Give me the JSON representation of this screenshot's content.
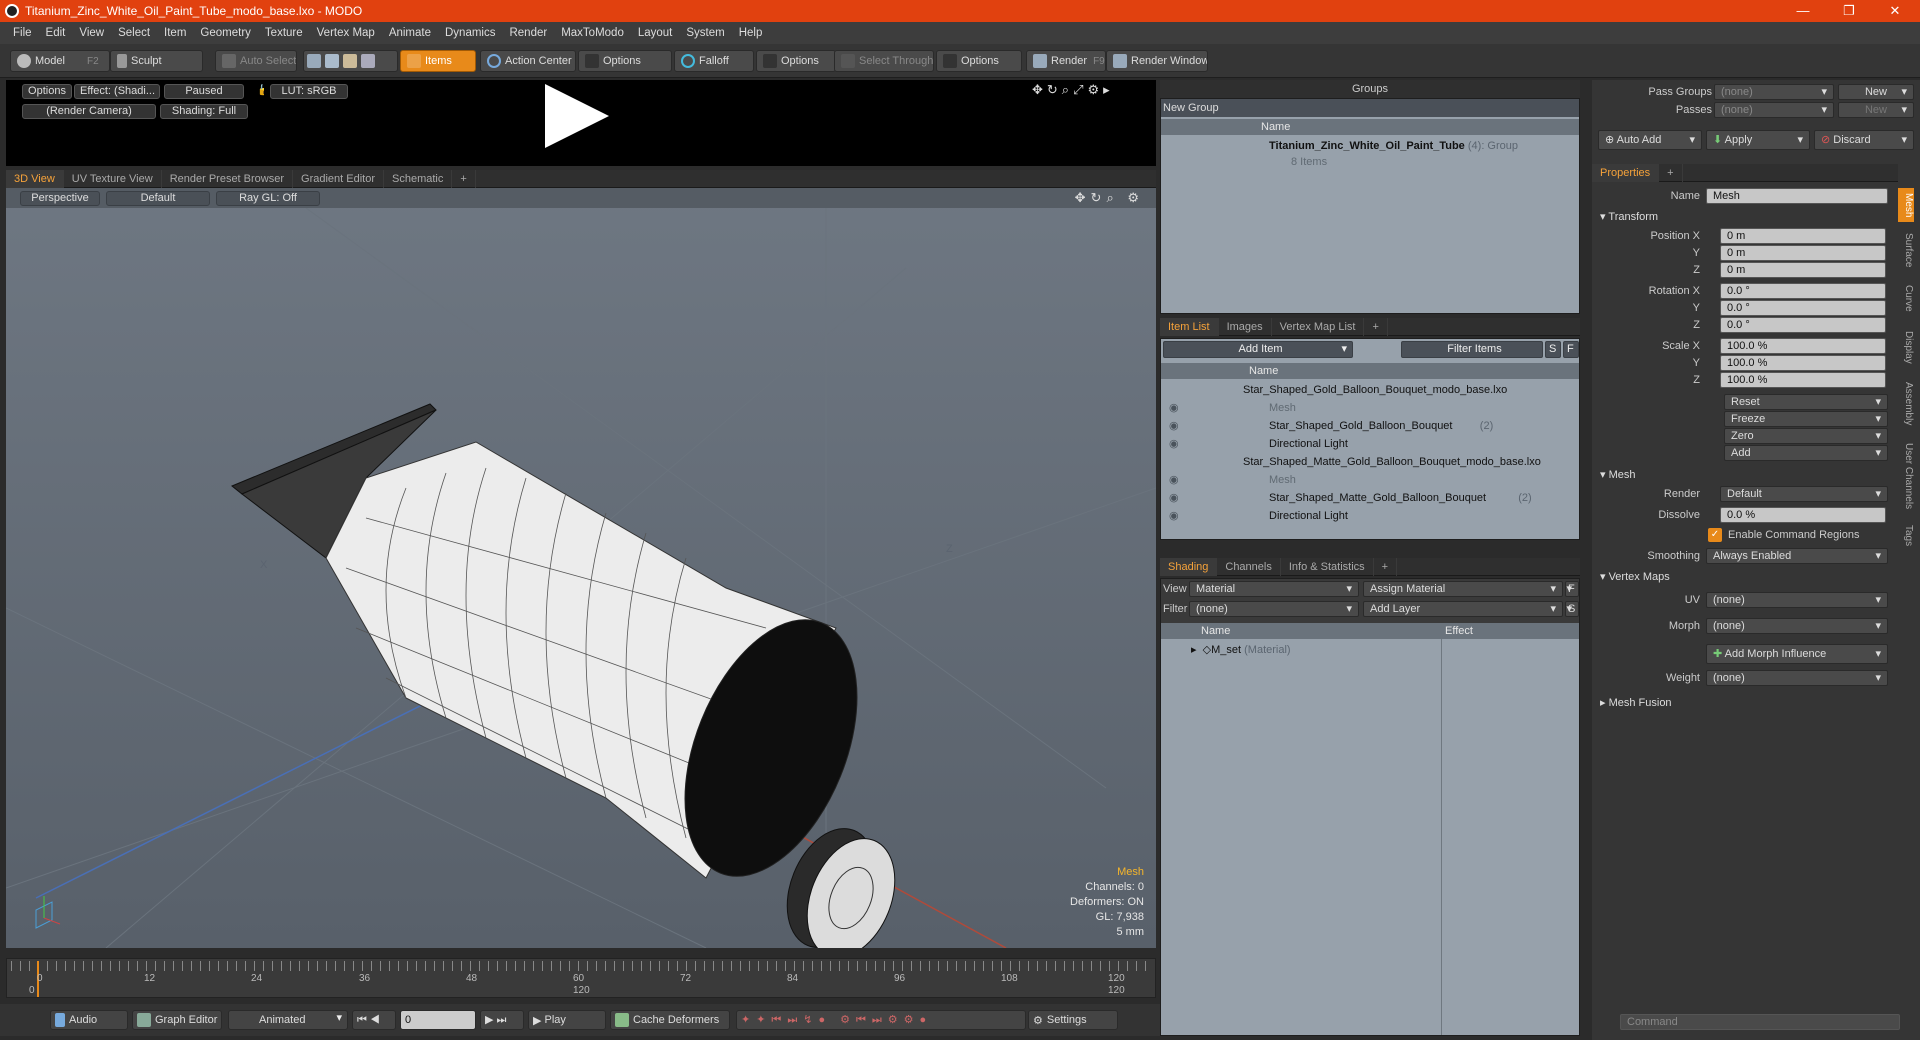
{
  "window": {
    "title": "Titanium_Zinc_White_Oil_Paint_Tube_modo_base.lxo - MODO",
    "minimize": "—",
    "restore": "❐",
    "close": "✕"
  },
  "menu": [
    "File",
    "Edit",
    "View",
    "Select",
    "Item",
    "Geometry",
    "Texture",
    "Vertex Map",
    "Animate",
    "Dynamics",
    "Render",
    "MaxToModo",
    "Layout",
    "System",
    "Help"
  ],
  "toolbar": {
    "model": "Model",
    "model_key": "F2",
    "sculpt": "Sculpt",
    "auto_select": "Auto Select",
    "items": "Items",
    "action_center": "Action Center",
    "options1": "Options",
    "falloff": "Falloff",
    "options2": "Options",
    "select_through": "Select Through",
    "options3": "Options",
    "render": "Render",
    "render_key": "F9",
    "render_window": "Render Window"
  },
  "preview": {
    "options": "Options",
    "effect": "Effect: (Shadi...",
    "paused": "Paused",
    "lut": "LUT: sRGB",
    "camera": "(Render Camera)",
    "shading": "Shading: Full"
  },
  "view_tabs": [
    "3D View",
    "UV Texture View",
    "Render Preset Browser",
    "Gradient Editor",
    "Schematic",
    "+"
  ],
  "viewport": {
    "projection": "Perspective",
    "style": "Default",
    "raygl": "Ray GL: Off",
    "hud": {
      "selection": "Mesh",
      "channels": "Channels: 0",
      "deformers": "Deformers: ON",
      "gl": "GL: 7,938",
      "unit": "5 mm"
    },
    "axis_x": "X",
    "axis_z": "Z"
  },
  "timeline": {
    "ticks": [
      "0",
      "12",
      "24",
      "36",
      "48",
      "60",
      "72",
      "84",
      "96",
      "108",
      "120"
    ],
    "sub_ticks": [
      "0",
      "120",
      "120"
    ]
  },
  "transport": {
    "audio": "Audio",
    "graph_editor": "Graph Editor",
    "animated": "Animated",
    "frame": "0",
    "play": "Play",
    "cache": "Cache Deformers",
    "settings": "Settings"
  },
  "groups": {
    "title": "Groups",
    "new_group": "New Group",
    "col_name": "Name",
    "item_name": "Titanium_Zinc_White_Oil_Paint_Tube",
    "item_count": "(4)",
    "item_type": ": Group",
    "item_sub": "8 Items"
  },
  "itemlist": {
    "tabs": [
      "Item List",
      "Images",
      "Vertex Map List",
      "+"
    ],
    "add_item": "Add Item",
    "filter": "Filter Items",
    "s": "S",
    "f": "F",
    "col_name": "Name",
    "rows": [
      {
        "label": "Star_Shaped_Gold_Balloon_Bouquet_modo_base.lxo",
        "count": "",
        "indent": 0,
        "gray": false
      },
      {
        "label": "Mesh",
        "count": "",
        "indent": 2,
        "gray": true
      },
      {
        "label": "Star_Shaped_Gold_Balloon_Bouquet",
        "count": "(2)",
        "indent": 2,
        "gray": false
      },
      {
        "label": "Directional Light",
        "count": "",
        "indent": 2,
        "gray": false
      },
      {
        "label": "Star_Shaped_Matte_Gold_Balloon_Bouquet_modo_base.lxo",
        "count": "",
        "indent": 0,
        "gray": false
      },
      {
        "label": "Mesh",
        "count": "",
        "indent": 2,
        "gray": true
      },
      {
        "label": "Star_Shaped_Matte_Gold_Balloon_Bouquet",
        "count": "(2)",
        "indent": 2,
        "gray": false
      },
      {
        "label": "Directional Light",
        "count": "",
        "indent": 2,
        "gray": false
      }
    ]
  },
  "shading": {
    "tabs": [
      "Shading",
      "Channels",
      "Info & Statistics",
      "+"
    ],
    "view_label": "View",
    "view_value": "Material",
    "assign": "Assign Material",
    "f": "F",
    "filter_label": "Filter",
    "filter_value": "(none)",
    "add_layer": "Add Layer",
    "s": "S",
    "col_name": "Name",
    "col_effect": "Effect",
    "row_name": "M_set",
    "row_type": "(Material)"
  },
  "passes": {
    "pass_groups": "Pass Groups",
    "pass_value": "(none)",
    "new1": "New",
    "passes": "Passes",
    "passes_value": "(none)",
    "new2": "New",
    "auto_add": "Auto Add",
    "apply": "Apply",
    "discard": "Discard"
  },
  "properties": {
    "tab": "Properties",
    "name_label": "Name",
    "name_value": "Mesh",
    "transform": "Transform",
    "position_label": "Position X",
    "y": "Y",
    "z": "Z",
    "pos": [
      "0 m",
      "0 m",
      "0 m"
    ],
    "rotation_label": "Rotation X",
    "rot": [
      "0.0 °",
      "0.0 °",
      "0.0 °"
    ],
    "scale_label": "Scale X",
    "scale": [
      "100.0 %",
      "100.0 %",
      "100.0 %"
    ],
    "actions": [
      "Reset",
      "Freeze",
      "Zero",
      "Add"
    ],
    "mesh": "Mesh",
    "render_label": "Render",
    "render_value": "Default",
    "dissolve_label": "Dissolve",
    "dissolve_value": "0.0 %",
    "enable_cmd": "Enable Command Regions",
    "smoothing_label": "Smoothing",
    "smoothing_value": "Always Enabled",
    "vertex_maps": "Vertex Maps",
    "uv_label": "UV",
    "uv_value": "(none)",
    "morph_label": "Morph",
    "morph_value": "(none)",
    "add_morph": "Add Morph Influence",
    "weight_label": "Weight",
    "weight_value": "(none)",
    "mesh_fusion": "Mesh Fusion",
    "side_tabs": [
      "Mesh",
      "Surface",
      "Curve",
      "Display",
      "Assembly",
      "User Channels",
      "Tags"
    ]
  },
  "command": {
    "placeholder": "Command"
  },
  "colors": {
    "accent": "#e88a1a",
    "title": "#e1410f",
    "pane": "#97a1ab"
  }
}
